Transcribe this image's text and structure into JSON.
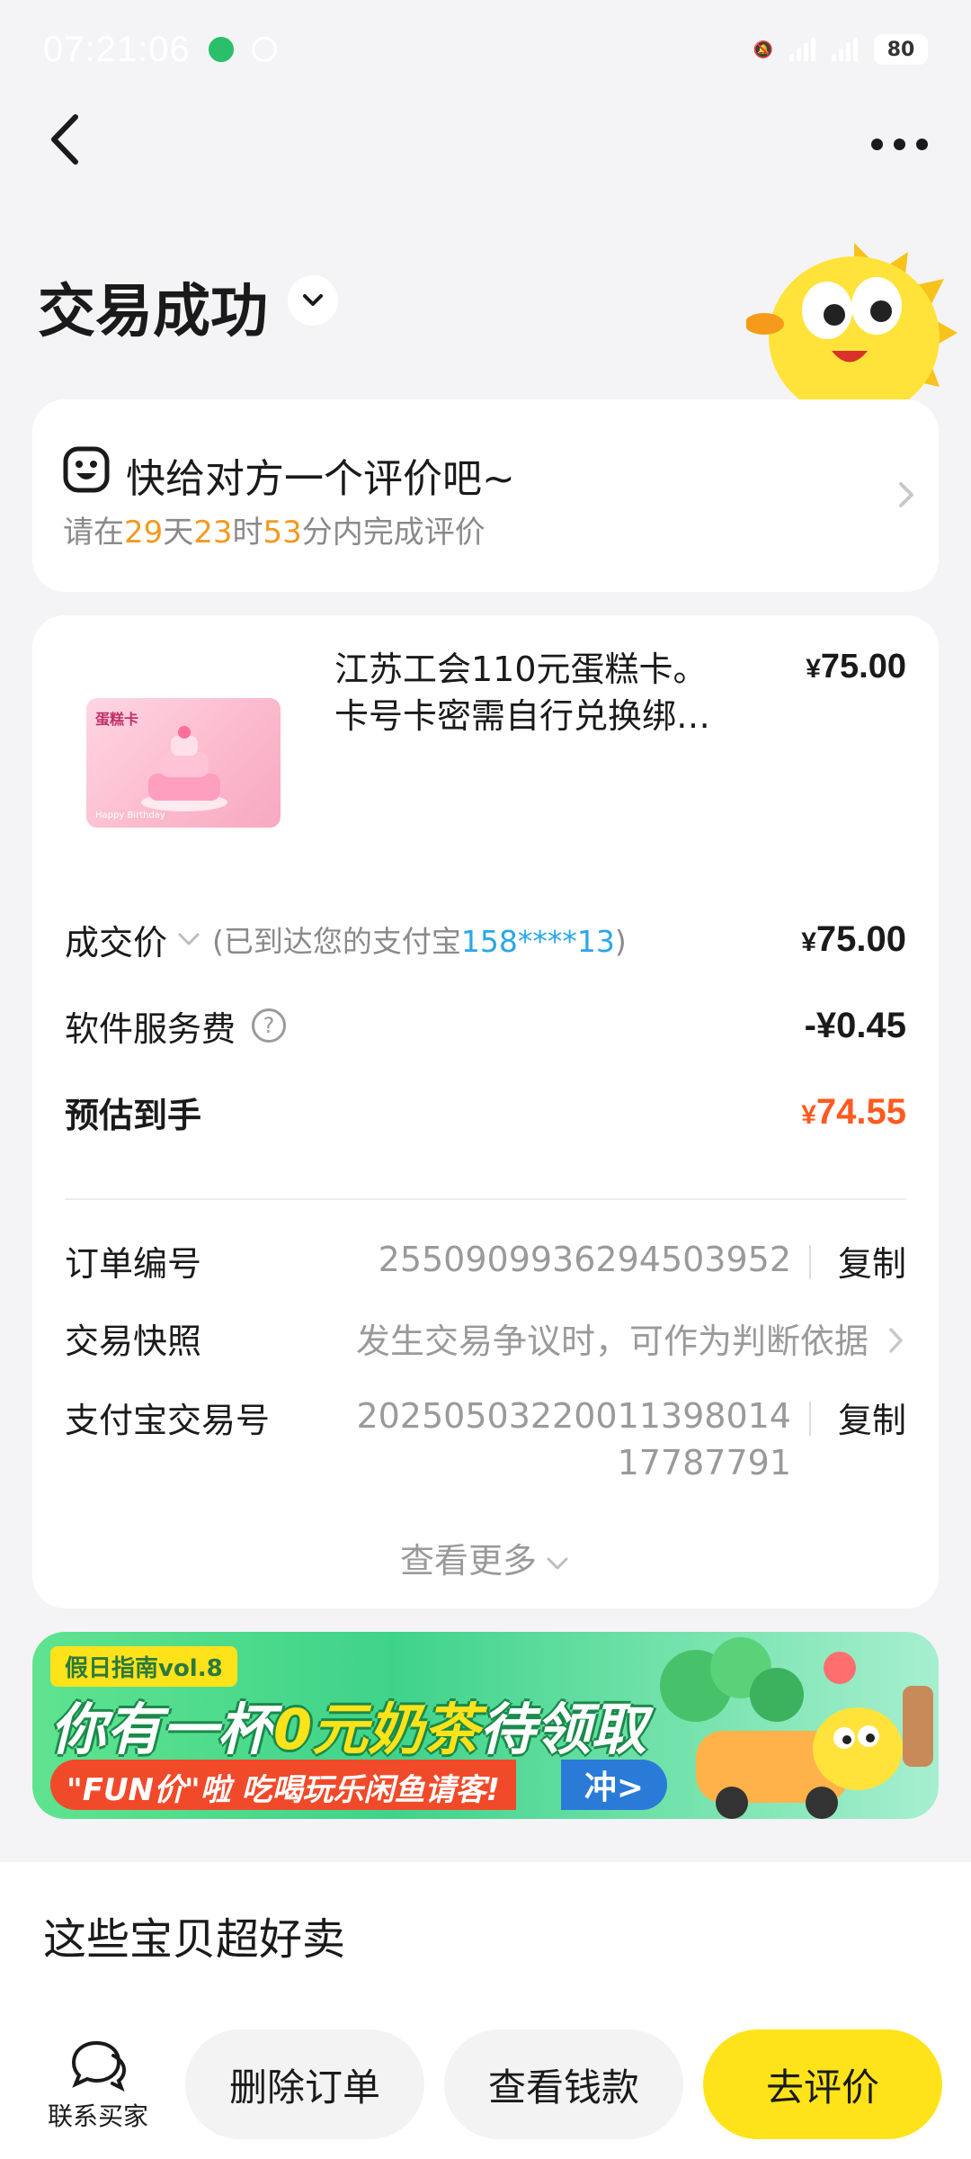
{
  "status_bar": {
    "time": "07:21:06",
    "battery": "80"
  },
  "header": {
    "title": "交易成功"
  },
  "review": {
    "title": "快给对方一个评价吧~",
    "sub_prefix": "请在",
    "days": "29",
    "days_unit": "天",
    "hours": "23",
    "hours_unit": "时",
    "minutes": "53",
    "minutes_unit": "分内完成评价"
  },
  "product": {
    "title_line1": "江苏工会110元蛋糕卡。",
    "title_line2": "卡号卡密需自行兑换绑…",
    "price": "75.00",
    "image_label": "蛋糕卡",
    "image_foot": "Happy Birthday"
  },
  "pricing": {
    "currency": "¥",
    "deal_label": "成交价",
    "deal_note_prefix": "(已到达您的支付宝",
    "deal_account": "158****13",
    "deal_note_suffix": ")",
    "deal_amount": "75.00",
    "fee_label": "软件服务费",
    "fee_amount": "-¥0.45",
    "estimate_label": "预估到手",
    "estimate_amount": "74.55"
  },
  "order_info": {
    "order_no_label": "订单编号",
    "order_no": "2550909936294503952",
    "copy": "复制",
    "snapshot_label": "交易快照",
    "snapshot_value": "发生交易争议时，可作为判断依据",
    "alipay_label": "支付宝交易号",
    "alipay_no": "202505032200113980 14 17787791",
    "alipay_line1": "2025050322001139801 4",
    "alipay_line1_clean": "20250503220011398014",
    "alipay_line2": "17787791",
    "see_more": "查看更多"
  },
  "banner": {
    "tag": "假日指南vol.8",
    "headline_a": "你有一杯",
    "headline_b": "0元奶茶",
    "headline_c": "待领取",
    "sub": "\"FUN价\"啦 吃喝玩乐闲鱼请客!",
    "go": "冲>"
  },
  "recommend": {
    "title": "这些宝贝超好卖"
  },
  "bottom": {
    "contact": "联系买家",
    "delete": "删除订单",
    "money": "查看钱款",
    "review": "去评价"
  },
  "colors": {
    "accent_yellow": "#ffe31a",
    "highlight_orange": "#f29a1f",
    "estimate_red": "#ff5a1f",
    "link_blue": "#2aa6e8"
  }
}
